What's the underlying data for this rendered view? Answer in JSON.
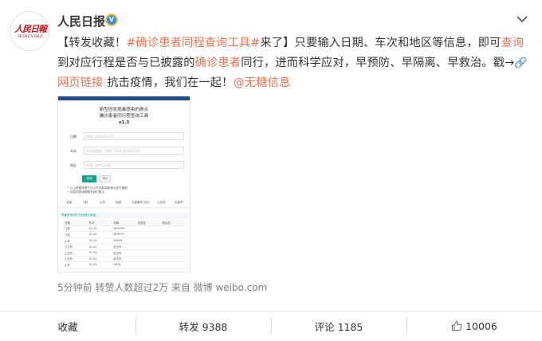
{
  "user": {
    "name": "人民日报",
    "avatar_text": "人民日報",
    "avatar_sub": "PEOPLE'S DAILY"
  },
  "post": {
    "t1": "【转发收藏！",
    "hashtag": "#确诊患者同程查询工具#",
    "t2": "来了】只要输入日期、车次和地区等信息，即可",
    "kw1": "查询",
    "t3": "到对应行程是否与已披露的",
    "kw2": "确诊患者",
    "t4": "同行，进而科学应对，早预防、早隔离、早救治。戳→",
    "link_icon": "🔗",
    "link": "网页链接",
    "t5": " 抗击疫情，我们在一起！",
    "mention": "@无糖信息"
  },
  "image": {
    "title1": "新型冠状病毒感染的肺炎",
    "title2": "确诊患者同行程查询工具",
    "version": "v1.3",
    "rows": [
      {
        "label": "日期",
        "placeholder": "例如: 2020-01-20"
      },
      {
        "label": "车次",
        "placeholder": "车次或航班，例如: T123 或 MU1234"
      },
      {
        "label": "地区",
        "placeholder": "例如: 北京 (可选)"
      }
    ],
    "btn_primary": "查询",
    "btn_secondary": "清空",
    "note1": "* 以上数据来源于已公开的新闻报道与官方通报",
    "note2": "* 如发现错误请联系我们更正",
    "tabs": [
      "全部",
      "飞机",
      "火车",
      "地铁",
      "长途客车/大巴",
      "公交车",
      "出租车"
    ],
    "section": "早期发现同行已经确诊患者...",
    "table_head": [
      "日期",
      "车次",
      "车厢",
      "出发站",
      "到达站"
    ],
    "table_rows": [
      [
        "飞机",
        "01-20",
        "MU5****",
        "",
        ""
      ],
      [
        "飞机",
        "01-20",
        "MU5****",
        "",
        ""
      ],
      [
        "火车",
        "01-20",
        "D3098",
        "",
        ""
      ],
      [
        "公交车",
        "01-20",
        "武汉市...",
        "",
        ""
      ],
      [
        "公交车",
        "01-20",
        "武汉市...",
        "",
        ""
      ],
      [
        "公交车",
        "01-20",
        "武汉市...",
        "",
        ""
      ],
      [
        "火车",
        "01-20",
        "G814",
        "",
        ""
      ]
    ]
  },
  "meta": "5分钟前 转赞人数超过2万  来自 微博 weibo.com",
  "footer": {
    "fav": "收藏",
    "repost": "转发 9388",
    "comment": "评论 1185",
    "like": "10006"
  },
  "colors": {
    "accent": "#eb7350",
    "verified": "#3a8ee6",
    "brand_red": "#c4161c",
    "image_button": "#1aa38b"
  }
}
